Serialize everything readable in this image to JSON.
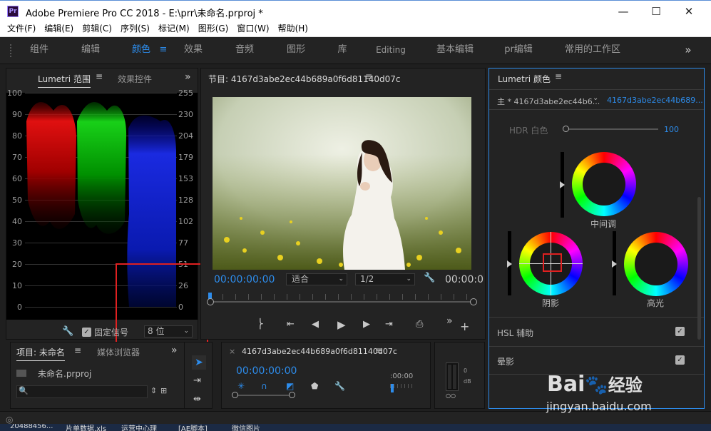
{
  "window": {
    "title": "Adobe Premiere Pro CC 2018 - E:\\prr\\未命名.prproj *",
    "icon": "Pr",
    "min": "—",
    "max": "☐",
    "close": "✕"
  },
  "menu": [
    "文件(F)",
    "编辑(E)",
    "剪辑(C)",
    "序列(S)",
    "标记(M)",
    "图形(G)",
    "窗口(W)",
    "帮助(H)"
  ],
  "workspaces": [
    "组件",
    "编辑",
    "颜色",
    "效果",
    "音频",
    "图形",
    "库",
    "Editing",
    "基本编辑",
    "pr编辑",
    "常用的工作区"
  ],
  "workspace_more": "»",
  "scopes": {
    "tab1": "Lumetri 范围",
    "tab2": "效果控件",
    "left_ticks": [
      "100",
      "90",
      "80",
      "70",
      "60",
      "50",
      "40",
      "30",
      "20",
      "10",
      "0"
    ],
    "right_ticks": [
      "255",
      "230",
      "204",
      "179",
      "153",
      "128",
      "102",
      "77",
      "51",
      "26",
      "0"
    ],
    "clamp_label": "固定信号",
    "bits": "8 位"
  },
  "program": {
    "title": "节目: 4167d3abe2ec44b689a0f6d81140d07c",
    "timecode": "00:00:00:00",
    "fit": "适合",
    "res": "1/2",
    "timecode_right": "00:00:0"
  },
  "lumetri": {
    "title": "Lumetri 颜色",
    "master": "主 * 4167d3abe2ec44b6...",
    "seq": "4167d3abe2ec44b689...",
    "hdr_label": "HDR 白色",
    "hdr_value": "100",
    "midtone": "中间调",
    "shadow": "阴影",
    "highlight": "高光",
    "hsl": "HSL 辅助",
    "vignette": "晕影"
  },
  "project": {
    "tab1": "项目: 未命名",
    "tab2": "媒体浏览器",
    "file": "未命名.prproj"
  },
  "timeline": {
    "title": "4167d3abe2ec44b689a0f6d81140d07c",
    "timecode": "00:00:00:00",
    "ruler": ":00:00"
  },
  "meter": {
    "zero": "0",
    "db": "dB"
  },
  "taskbar": [
    "20488456...",
    "片单数据.xls",
    "运营中心理",
    "[AE脚本]",
    "微信图片"
  ],
  "watermark": {
    "brand": "Bai",
    "brand2": "经验",
    "url": "jingyan.baidu.com"
  }
}
